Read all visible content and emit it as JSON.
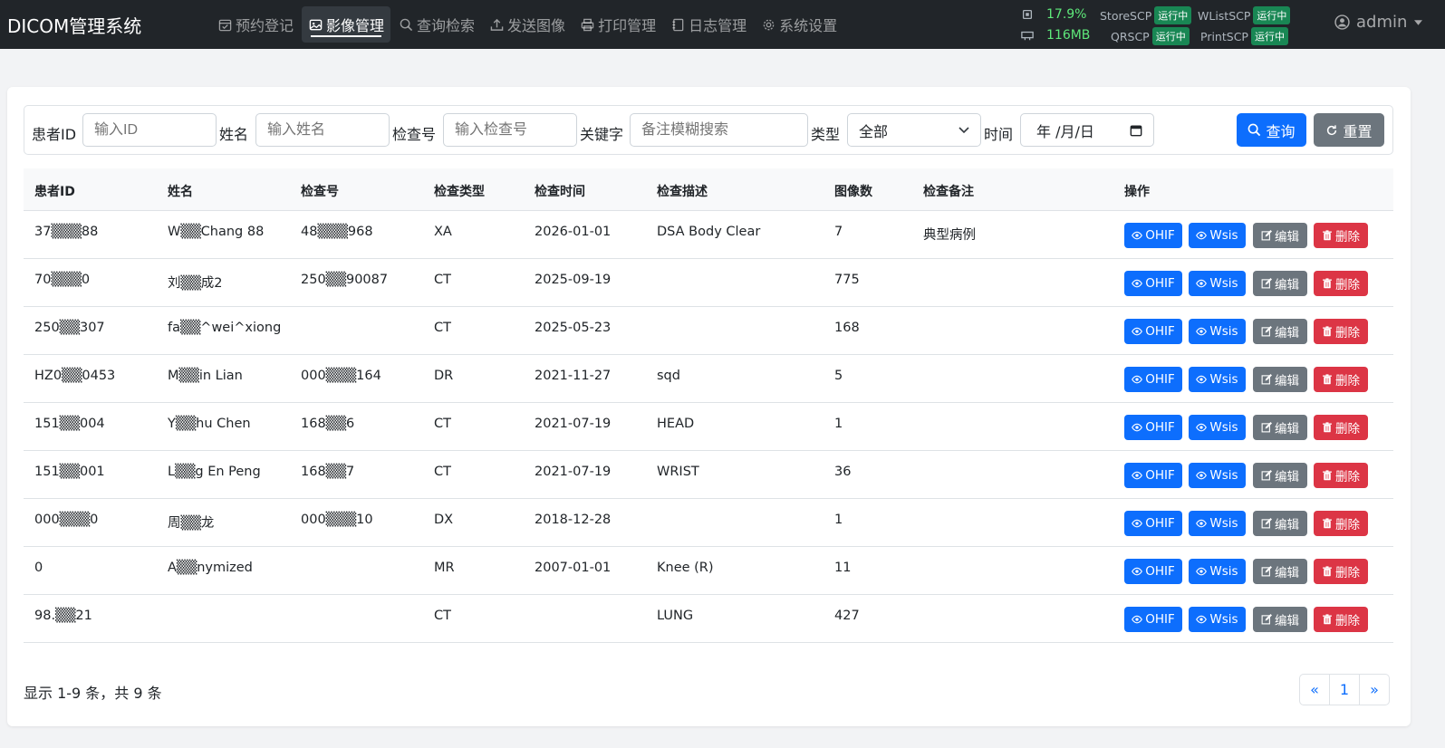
{
  "app": {
    "title": "DICOM管理系统"
  },
  "nav": [
    {
      "label": "预约登记",
      "icon": "calendar-check-icon"
    },
    {
      "label": "影像管理",
      "icon": "image-icon",
      "active": true
    },
    {
      "label": "查询检索",
      "icon": "search-icon"
    },
    {
      "label": "发送图像",
      "icon": "upload-icon"
    },
    {
      "label": "打印管理",
      "icon": "printer-icon"
    },
    {
      "label": "日志管理",
      "icon": "journal-icon"
    },
    {
      "label": "系统设置",
      "icon": "gear-icon"
    }
  ],
  "status": {
    "cpu": "17.9%",
    "memory": "116MB",
    "services": [
      {
        "name": "StoreSCP",
        "state": "运行中"
      },
      {
        "name": "WListSCP",
        "state": "运行中"
      },
      {
        "name": "QRSCP",
        "state": "运行中"
      },
      {
        "name": "PrintSCP",
        "state": "运行中"
      }
    ]
  },
  "user": {
    "name": "admin"
  },
  "filters": {
    "patient_id": {
      "label": "患者ID",
      "placeholder": "输入ID"
    },
    "name": {
      "label": "姓名",
      "placeholder": "输入姓名"
    },
    "exam_no": {
      "label": "检查号",
      "placeholder": "输入检查号"
    },
    "keyword": {
      "label": "关键字",
      "placeholder": "备注模糊搜索"
    },
    "type": {
      "label": "类型",
      "value": "全部"
    },
    "time": {
      "label": "时间",
      "value": "年 /月/日"
    },
    "search_label": "查询",
    "reset_label": "重置"
  },
  "table": {
    "headers": [
      "患者ID",
      "姓名",
      "检查号",
      "检查类型",
      "检查时间",
      "检查描述",
      "图像数",
      "检查备注",
      "操作"
    ],
    "actions": {
      "ohif": "OHIF",
      "wsis": "Wsis",
      "edit": "编辑",
      "delete": "删除"
    },
    "rows": [
      {
        "pid": "37▒▒▒88",
        "name": "W▒▒Chang 88",
        "exam": "48▒▒▒968",
        "type": "XA",
        "date": "2026-01-01",
        "desc": "DSA Body Clear",
        "images": "7",
        "note": "典型病例"
      },
      {
        "pid": "70▒▒▒0",
        "name": "刘▒▒成2",
        "exam": "250▒▒90087",
        "type": "CT",
        "date": "2025-09-19",
        "desc": "",
        "images": "775",
        "note": ""
      },
      {
        "pid": "250▒▒307",
        "name": "fa▒▒^wei^xiong",
        "exam": "",
        "type": "CT",
        "date": "2025-05-23",
        "desc": "",
        "images": "168",
        "note": ""
      },
      {
        "pid": "HZ0▒▒0453",
        "name": "M▒▒in Lian",
        "exam": "000▒▒▒164",
        "type": "DR",
        "date": "2021-11-27",
        "desc": "sqd",
        "images": "5",
        "note": ""
      },
      {
        "pid": "151▒▒004",
        "name": "Y▒▒hu Chen",
        "exam": "168▒▒6",
        "type": "CT",
        "date": "2021-07-19",
        "desc": "HEAD",
        "images": "1",
        "note": ""
      },
      {
        "pid": "151▒▒001",
        "name": "L▒▒g En Peng",
        "exam": "168▒▒7",
        "type": "CT",
        "date": "2021-07-19",
        "desc": "WRIST",
        "images": "36",
        "note": ""
      },
      {
        "pid": "000▒▒▒0",
        "name": "周▒▒龙",
        "exam": "000▒▒▒10",
        "type": "DX",
        "date": "2018-12-28",
        "desc": "",
        "images": "1",
        "note": ""
      },
      {
        "pid": "0",
        "name": "A▒▒nymized",
        "exam": "",
        "type": "MR",
        "date": "2007-01-01",
        "desc": "Knee (R)",
        "images": "11",
        "note": ""
      },
      {
        "pid": "98.▒▒21",
        "name": "",
        "exam": "",
        "type": "CT",
        "date": "",
        "desc": "LUNG",
        "images": "427",
        "note": ""
      }
    ]
  },
  "footer": {
    "summary": "显示 1-9 条，共 9 条",
    "pages": [
      "«",
      "1",
      "»"
    ]
  },
  "colors": {
    "navbar": "#212529",
    "primary": "#0d6efd",
    "secondary": "#6c757d",
    "danger": "#dc3545",
    "running": "#198754",
    "metric": "#5ee87a"
  }
}
